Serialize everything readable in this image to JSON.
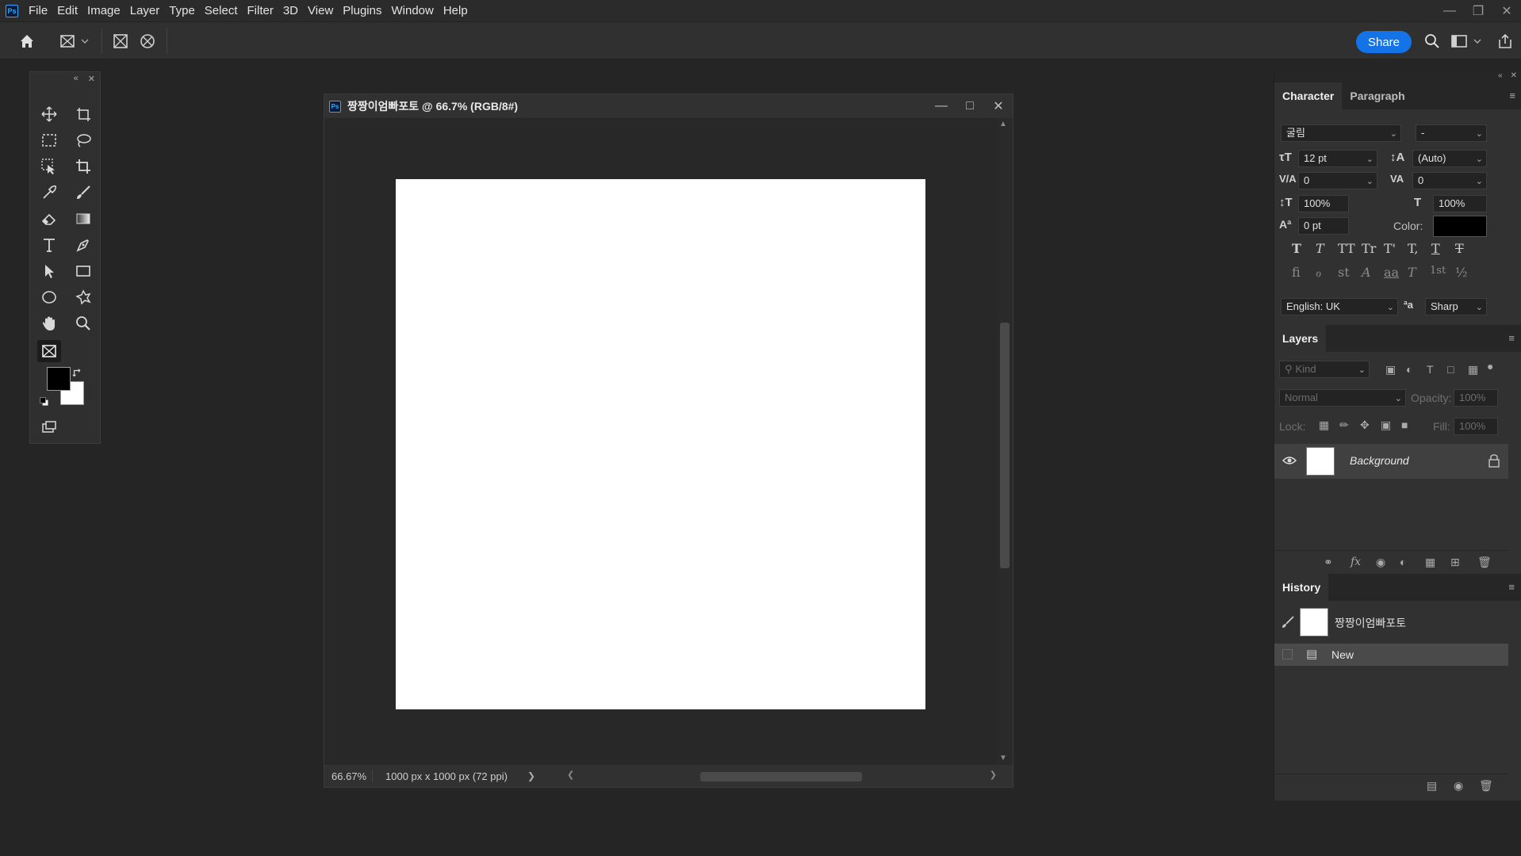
{
  "app": {
    "logo": "Ps",
    "menu": [
      "File",
      "Edit",
      "Image",
      "Layer",
      "Type",
      "Select",
      "Filter",
      "3D",
      "View",
      "Plugins",
      "Window",
      "Help"
    ],
    "window_controls": [
      "minimize-icon",
      "restore-icon",
      "close-icon"
    ]
  },
  "options_bar": {
    "share_label": "Share",
    "icons": [
      "home-icon",
      "frame-tool-icon",
      "rect-frame-icon",
      "ellipse-frame-icon",
      "search-icon",
      "workspace-icon",
      "share-export-icon"
    ]
  },
  "toolbox": {
    "tools": [
      "move-tool",
      "artboard-tool",
      "marquee-tool",
      "lasso-tool",
      "object-select-tool",
      "crop-tool",
      "eyedropper-tool",
      "brush-tool",
      "eraser-tool",
      "gradient-tool",
      "type-tool",
      "pen-tool",
      "path-select-tool",
      "rectangle-tool",
      "ellipse-tool",
      "custom-shape-tool",
      "hand-tool",
      "zoom-tool",
      "frame-tool"
    ],
    "foreground_color": "#000000",
    "background_color": "#ffffff"
  },
  "document": {
    "title": "짱짱이엄빠포토 @ 66.7% (RGB/8#)",
    "zoom": "66.67%",
    "info": "1000 px x 1000 px (72 ppi)"
  },
  "character": {
    "tabs": [
      "Character",
      "Paragraph"
    ],
    "font_family": "굴림",
    "font_style": "-",
    "font_size": "12 pt",
    "leading": "(Auto)",
    "kerning": "0",
    "tracking": "0",
    "vertical_scale": "100%",
    "horizontal_scale": "100%",
    "baseline_shift": "0 pt",
    "color_label": "Color:",
    "color_value": "#000000",
    "style_glyphs": [
      "T",
      "T",
      "TT",
      "Tr",
      "T'",
      "T,",
      "T",
      "T"
    ],
    "opentype_glyphs": [
      "fi",
      "ℴ",
      "st",
      "A",
      "aa",
      "T",
      "1st",
      "½"
    ],
    "language": "English: UK",
    "aa_icon": "ªa",
    "antialias": "Sharp"
  },
  "layers": {
    "tab": "Layers",
    "filter_placeholder": "Kind",
    "blend_mode": "Normal",
    "opacity_label": "Opacity:",
    "opacity_value": "100%",
    "lock_label": "Lock:",
    "fill_label": "Fill:",
    "fill_value": "100%",
    "items": [
      {
        "name": "Background",
        "visible": true,
        "locked": true
      }
    ]
  },
  "history": {
    "tab": "History",
    "snapshot_name": "짱짱이엄빠포토",
    "steps": [
      "New"
    ]
  }
}
